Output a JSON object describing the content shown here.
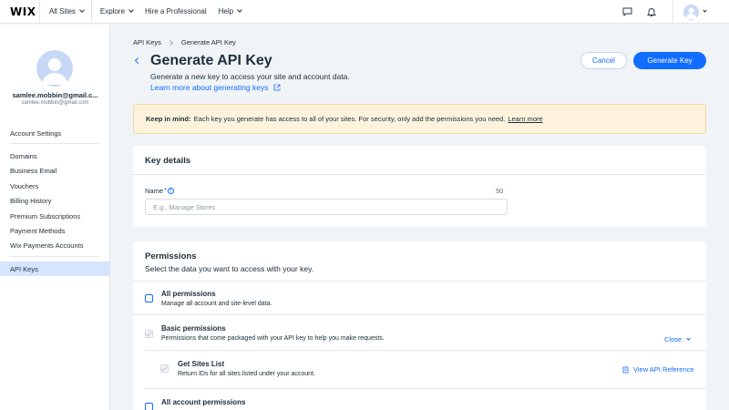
{
  "topbar": {
    "logo": "WIX",
    "nav": [
      {
        "label": "All Sites",
        "dropdown": true
      },
      {
        "label": "Explore",
        "dropdown": true
      },
      {
        "label": "Hire a Professional",
        "dropdown": false
      },
      {
        "label": "Help",
        "dropdown": true
      }
    ],
    "icons": [
      "chat-icon",
      "bell-icon",
      "avatar",
      "chevron-down-icon"
    ]
  },
  "sidebar": {
    "user_name": "samlee.mobbin@gmail.c...",
    "user_email": "samlee.mobbin@gmail.com",
    "account_settings": "Account Settings",
    "items": [
      {
        "label": "Domains"
      },
      {
        "label": "Business Email"
      },
      {
        "label": "Vouchers"
      },
      {
        "label": "Billing History"
      },
      {
        "label": "Premium Subscriptions"
      },
      {
        "label": "Payment Methods"
      },
      {
        "label": "Wix Payments Accounts"
      }
    ],
    "active_item": "API Keys"
  },
  "breadcrumb": [
    "API Keys",
    "Generate API Key"
  ],
  "header": {
    "title": "Generate API Key",
    "subtitle": "Generate a new key to access your site and account data.",
    "learn_link": "Learn more about generating keys",
    "cancel_label": "Cancel",
    "generate_label": "Generate Key"
  },
  "notice": {
    "bold": "Keep in mind:",
    "text": "Each key you generate has access to all of your sites. For security, only add the permissions you need.",
    "link": "Learn more"
  },
  "key_details": {
    "title": "Key details",
    "field_label": "Name",
    "required_mark": "*",
    "char_limit": "50",
    "placeholder": "E.g., Manage Stores",
    "value": ""
  },
  "permissions": {
    "title": "Permissions",
    "description": "Select the data you want to access with your key.",
    "rows": [
      {
        "title": "All permissions",
        "desc": "Manage all account and site-level data.",
        "checked": false,
        "disabled": false
      },
      {
        "title": "Basic permissions",
        "desc": "Permissions that come packaged with your API key to help you make requests.",
        "checked": true,
        "disabled": true,
        "action": "Close"
      },
      {
        "title": "Get Sites List",
        "desc": "Return IDs for all sites listed under your account.",
        "checked": true,
        "disabled": true,
        "action": "View API Reference"
      },
      {
        "title": "All account permissions",
        "desc": "",
        "checked": false,
        "disabled": false
      }
    ]
  },
  "colors": {
    "accent": "#116dff",
    "notice_bg": "#fdf3dd",
    "sidebar_active": "#d6e5fd",
    "page_bg": "#f0f4f7"
  }
}
